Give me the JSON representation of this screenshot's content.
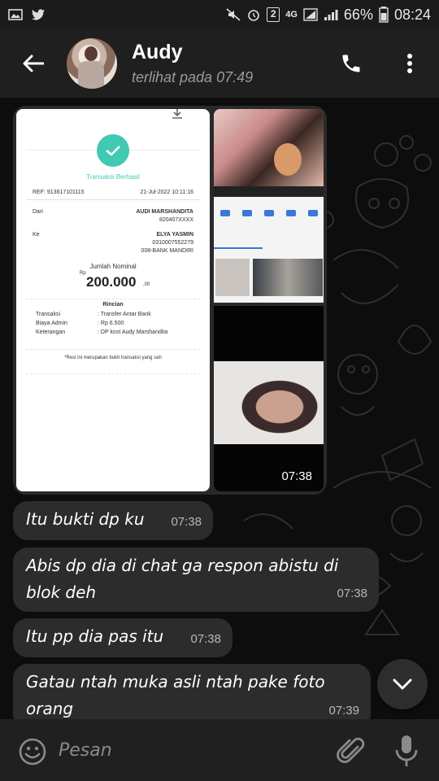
{
  "status_bar": {
    "sim_badge": "2",
    "network": "4G",
    "battery": "66%",
    "time": "08:24"
  },
  "header": {
    "contact_name": "Audy",
    "last_seen": "terlihat pada  07:49"
  },
  "media_message": {
    "time": "07:38",
    "receipt": {
      "status": "Transaksi Berhasil",
      "ref": "REF: 913617101115",
      "date": "21-Jul-2022 10:11:16",
      "from_label": "Dari",
      "from_name": "AUDI MARSHANDITA",
      "from_account": "820407XXXX",
      "to_label": "Ke",
      "to_name": "ELYA YASMIN",
      "to_account": "0310007552279",
      "to_bank": "008-BANK MANDIRI",
      "amount_label": "Jumlah Nominal",
      "currency": "Rp",
      "amount": "200.000",
      "amount_decimals": ",00",
      "details_label": "Rincian",
      "rows": [
        {
          "label": "Transaksi",
          "value": ": Transfer Antar Bank"
        },
        {
          "label": "Biaya Admin",
          "value": ": Rp 6.500"
        },
        {
          "label": "Keterangan",
          "value": ": DP kost Audy Marshandita"
        }
      ],
      "footer": "*Resi ini merupakan bukti transaksi yang sah"
    }
  },
  "messages": [
    {
      "text": "Itu bukti dp ku",
      "time": "07:38"
    },
    {
      "text": "Abis dp dia di chat ga respon abistu di blok deh",
      "time": "07:38"
    },
    {
      "text": "Itu pp dia pas itu",
      "time": "07:38"
    },
    {
      "text": "Gatau ntah muka asli ntah pake foto orang",
      "time": "07:39"
    }
  ],
  "input": {
    "placeholder": "Pesan"
  }
}
